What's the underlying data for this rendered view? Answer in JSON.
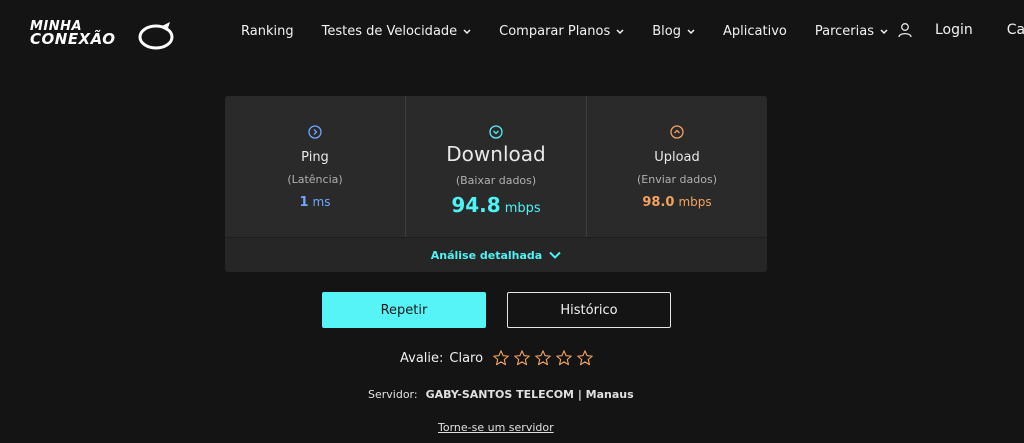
{
  "brand": {
    "line1": "MINHA",
    "line2": "CONEXÃO"
  },
  "nav": {
    "items": [
      {
        "label": "Ranking",
        "dropdown": false
      },
      {
        "label": "Testes de Velocidade",
        "dropdown": true
      },
      {
        "label": "Comparar Planos",
        "dropdown": true
      },
      {
        "label": "Blog",
        "dropdown": true
      },
      {
        "label": "Aplicativo",
        "dropdown": false
      },
      {
        "label": "Parcerias",
        "dropdown": true
      }
    ],
    "login": "Login",
    "signup_partial": "Cad"
  },
  "results": {
    "ping": {
      "title": "Ping",
      "subtitle": "(Latência)",
      "value": "1",
      "unit": "ms",
      "icon": "chevron-right-circle-icon"
    },
    "download": {
      "title": "Download",
      "subtitle": "(Baixar dados)",
      "value": "94.8",
      "unit": "mbps",
      "icon": "chevron-down-circle-icon"
    },
    "upload": {
      "title": "Upload",
      "subtitle": "(Enviar dados)",
      "value": "98.0",
      "unit": "mbps",
      "icon": "chevron-up-circle-icon"
    },
    "analysis_label": "Análise detalhada"
  },
  "actions": {
    "repeat": "Repetir",
    "history": "Histórico"
  },
  "rating": {
    "label": "Avalie:",
    "provider": "Claro",
    "stars_total": 5,
    "stars_filled": 0
  },
  "server": {
    "label": "Servidor:",
    "name": "GABY-SANTOS TELECOM | Manaus"
  },
  "become_server": "Torne-se um servidor",
  "colors": {
    "background": "#141414",
    "card": "#2a2a2a",
    "ping": "#6fa6ff",
    "download": "#4ef3f5",
    "upload": "#f3a25f",
    "primary_button": "#56f4f6"
  }
}
